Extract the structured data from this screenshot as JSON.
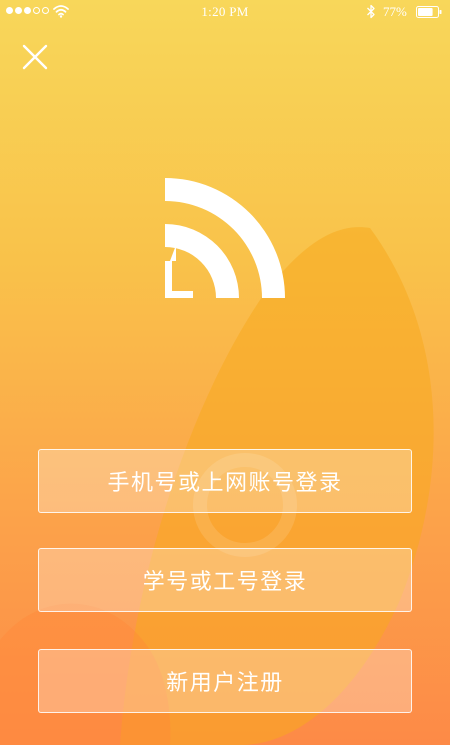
{
  "status_bar": {
    "signal_dots_filled": 3,
    "signal_dots_total": 5,
    "time": "1:20 PM",
    "battery_percent": "77%",
    "battery_level": 0.77,
    "icons": [
      "signal-dots-icon",
      "wifi-icon",
      "bluetooth-icon",
      "battery-icon"
    ]
  },
  "header": {
    "close_icon": "close-icon"
  },
  "logo": {
    "icon": "campus-network-logo-icon"
  },
  "actions": {
    "phone_login_label": "手机号或上网账号登录",
    "student_staff_login_label": "学号或工号登录",
    "register_label": "新用户注册"
  },
  "colors": {
    "gradient_top": "#f8d75a",
    "gradient_mid": "#f9c24a",
    "gradient_bottom": "#fd8a47",
    "button_border": "#ffffff",
    "text": "#ffffff"
  }
}
